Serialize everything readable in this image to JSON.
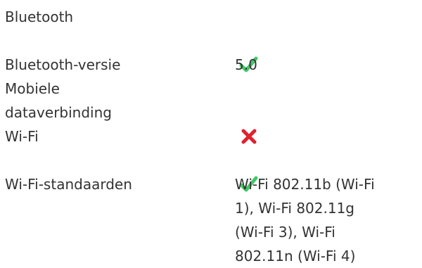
{
  "colors": {
    "yes": "#44c767",
    "no": "#e0212e",
    "text": "#333333"
  },
  "specs": [
    {
      "label": "Bluetooth",
      "value_icon": "check-icon"
    },
    {
      "label": "Bluetooth-versie",
      "value": "5.0"
    },
    {
      "label": "Mobiele\ndataverbinding",
      "value_icon": "cross-icon"
    },
    {
      "label": "Wi-Fi",
      "value_icon": "check-icon"
    },
    {
      "label": "Wi-Fi-standaarden",
      "value": "Wi-Fi 802.11b (Wi-Fi\n1), Wi-Fi 802.11g\n(Wi-Fi 3), Wi-Fi\n802.11n (Wi-Fi 4)"
    }
  ]
}
